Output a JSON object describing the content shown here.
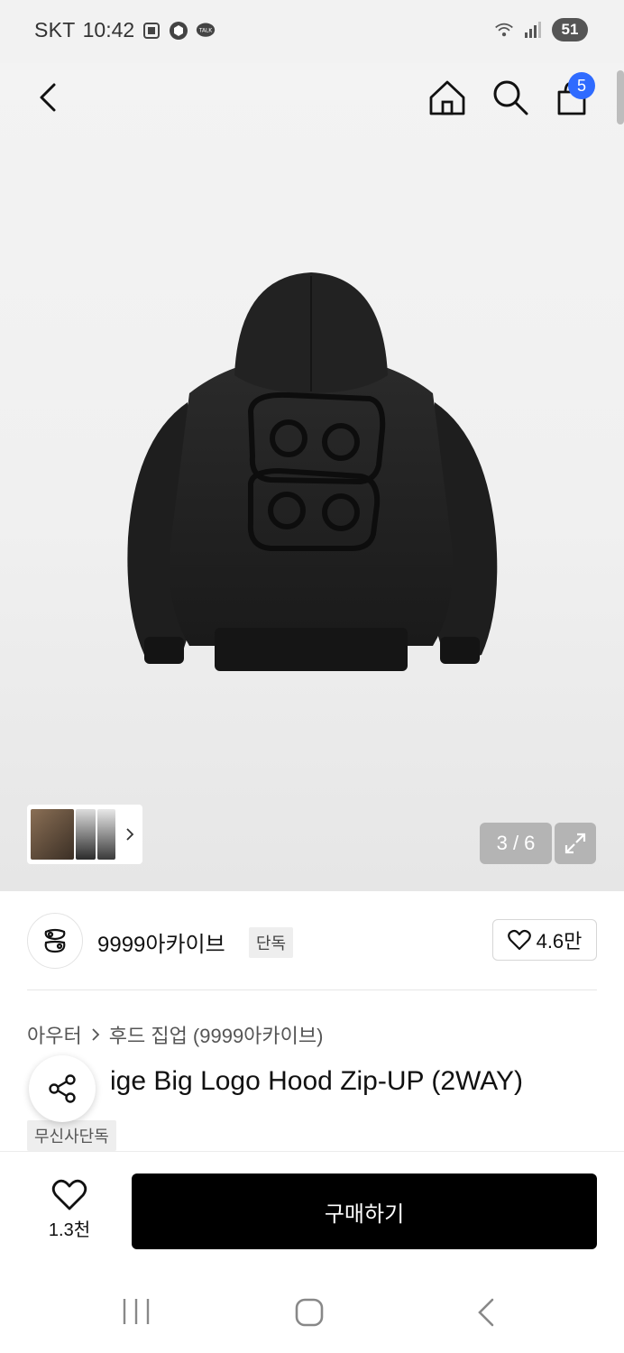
{
  "status_bar": {
    "carrier": "SKT",
    "time": "10:42",
    "battery": "51"
  },
  "header": {
    "cart_count": "5"
  },
  "gallery": {
    "page_indicator": "3 / 6"
  },
  "brand": {
    "name": "9999아카이브",
    "tag": "단독",
    "likes": "4.6만"
  },
  "breadcrumb": {
    "category": "아우터",
    "subcategory": "후드 집업 (9999아카이브)"
  },
  "product": {
    "title_visible": "ige Big Logo Hood Zip-UP (2WAY)",
    "tag": "무신사단독"
  },
  "bottom_bar": {
    "wish_count": "1.3천",
    "buy_label": "구매하기"
  },
  "colors": {
    "accent_badge": "#2f6bff",
    "buy_button": "#000000"
  }
}
